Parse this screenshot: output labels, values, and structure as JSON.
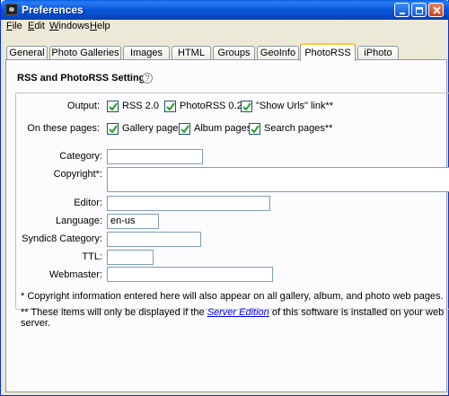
{
  "window": {
    "title": "Preferences"
  },
  "menu": [
    {
      "label": "File",
      "accel": "F",
      "rest": "ile"
    },
    {
      "label": "Edit",
      "accel": "E",
      "rest": "dit"
    },
    {
      "label": "Windows",
      "accel": "W",
      "rest": "indows"
    },
    {
      "label": "Help",
      "accel": "H",
      "rest": "elp"
    }
  ],
  "tabs": [
    "General",
    "Photo Galleries",
    "Images",
    "HTML",
    "Groups",
    "GeoInfo",
    "PhotoRSS",
    "iPhoto"
  ],
  "active_tab": "PhotoRSS",
  "section": {
    "title": "RSS and PhotoRSS Settings",
    "help": "?"
  },
  "output": {
    "label": "Output:",
    "options": [
      {
        "label": "RSS 2.0",
        "checked": true
      },
      {
        "label": "PhotoRSS 0.2",
        "checked": true
      },
      {
        "label": "\"Show Urls\" link**",
        "checked": true
      }
    ]
  },
  "pages": {
    "label": "On these pages:",
    "options": [
      {
        "label": "Gallery pages",
        "checked": true
      },
      {
        "label": "Album pages",
        "checked": true
      },
      {
        "label": "Search pages**",
        "checked": true
      }
    ]
  },
  "fields": {
    "category": {
      "label": "Category:",
      "value": ""
    },
    "copyright": {
      "label": "Copyright*:",
      "value": ""
    },
    "editor": {
      "label": "Editor:",
      "value": ""
    },
    "language": {
      "label": "Language:",
      "value": "en-us"
    },
    "syndic8": {
      "label": "Syndic8 Category:",
      "value": ""
    },
    "ttl": {
      "label": "TTL:",
      "value": ""
    },
    "webmaster": {
      "label": "Webmaster:",
      "value": ""
    }
  },
  "notes": {
    "copyright": "* Copyright information entered here will also appear on all gallery, album, and photo web pages.",
    "server_prefix": "** These items will only be displayed if the ",
    "server_link": "Server Edition",
    "server_suffix": " of this software is installed on your web server."
  }
}
